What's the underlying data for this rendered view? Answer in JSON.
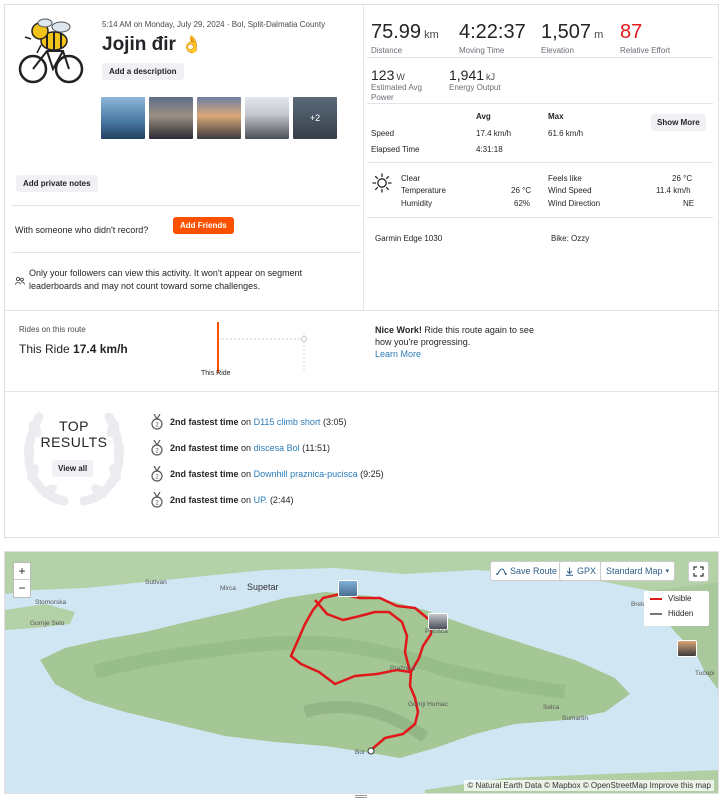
{
  "header": {
    "meta": "5:14 AM on Monday, July 29, 2024 · Bol, Split-Dalmatia County",
    "title": "Jojin đir",
    "title_emoji": "👌",
    "add_description_label": "Add a description",
    "photos_more_label": "+2",
    "add_private_notes_label": "Add private notes"
  },
  "social": {
    "prompt": "With someone who didn't record?",
    "add_friends_label": "Add Friends",
    "privacy_notice": "Only your followers can view this activity. It won't appear on segment leaderboards and may not count toward some challenges."
  },
  "stats": {
    "distance": {
      "value": "75.99",
      "unit": "km",
      "label": "Distance"
    },
    "moving_time": {
      "value": "4:22:37",
      "label": "Moving Time"
    },
    "elevation": {
      "value": "1,507",
      "unit": "m",
      "label": "Elevation"
    },
    "relative_effort": {
      "value": "87",
      "label": "Relative Effort"
    },
    "power": {
      "value": "123",
      "unit": "W",
      "label": "Estimated Avg Power"
    },
    "energy": {
      "value": "1,941",
      "unit": "kJ",
      "label": "Energy Output"
    }
  },
  "details": {
    "avg_header": "Avg",
    "max_header": "Max",
    "show_more_label": "Show More",
    "speed_label": "Speed",
    "speed_avg": "17.4 km/h",
    "speed_max": "61.6 km/h",
    "elapsed_label": "Elapsed Time",
    "elapsed_value": "4:31:18"
  },
  "weather": {
    "condition": "Clear",
    "temperature_label": "Temperature",
    "temperature_value": "26 °C",
    "humidity_label": "Humidity",
    "humidity_value": "62%",
    "feels_like_label": "Feels like",
    "feels_like_value": "26 °C",
    "wind_speed_label": "Wind Speed",
    "wind_speed_value": "11.4 km/h",
    "wind_direction_label": "Wind Direction",
    "wind_direction_value": "NE",
    "device": "Garmin Edge 1030",
    "bike": "Bike: Ozzy"
  },
  "route": {
    "label": "Rides on this route",
    "this_ride_prefix": "This Ride",
    "this_ride_value": "17.4 km/h",
    "bar_label": "This Ride",
    "nice_work_bold": "Nice Work!",
    "nice_work_text": "Ride this route again to see how you're progressing.",
    "learn_more": "Learn More"
  },
  "top_results": {
    "title_line1": "TOP",
    "title_line2": "RESULTS",
    "view_all_label": "View all",
    "items": [
      {
        "rank_text": "2nd fastest time",
        "on": "on",
        "segment": "D115 climb short",
        "time": "(3:05)"
      },
      {
        "rank_text": "2nd fastest time",
        "on": "on",
        "segment": "discesa Bol",
        "time": "(11:51)"
      },
      {
        "rank_text": "2nd fastest time",
        "on": "on",
        "segment": "Downhill praznica-pucisca",
        "time": "(9:25)"
      },
      {
        "rank_text": "2nd fastest time",
        "on": "on",
        "segment": "UP.",
        "time": "(2:44)"
      }
    ]
  },
  "map": {
    "zoom_in": "+",
    "zoom_out": "−",
    "save_route_label": "Save Route",
    "gpx_label": "GPX",
    "map_style_label": "Standard Map",
    "legend_visible": "Visible",
    "legend_hidden": "Hidden",
    "credit": "© Natural Earth Data © Mapbox © OpenStreetMap Improve this map",
    "places": {
      "sutivan": "Sutivan",
      "mirca": "Mirca",
      "supetar": "Supetar",
      "stomorska": "Stomorska",
      "gornje_selo": "Gornje Selo",
      "pucisca": "Pučišća",
      "praznica": "Pražnica",
      "gornji_humac": "Gornji Humac",
      "selca": "Selca",
      "sumartin": "Sumartin",
      "bol": "Bol",
      "brela": "Brela",
      "tucepi": "Tučepi"
    },
    "colors": {
      "route": "#e0171b",
      "hidden": "#777777",
      "sea": "#d0e6f3",
      "land": "#a8c99a"
    }
  }
}
